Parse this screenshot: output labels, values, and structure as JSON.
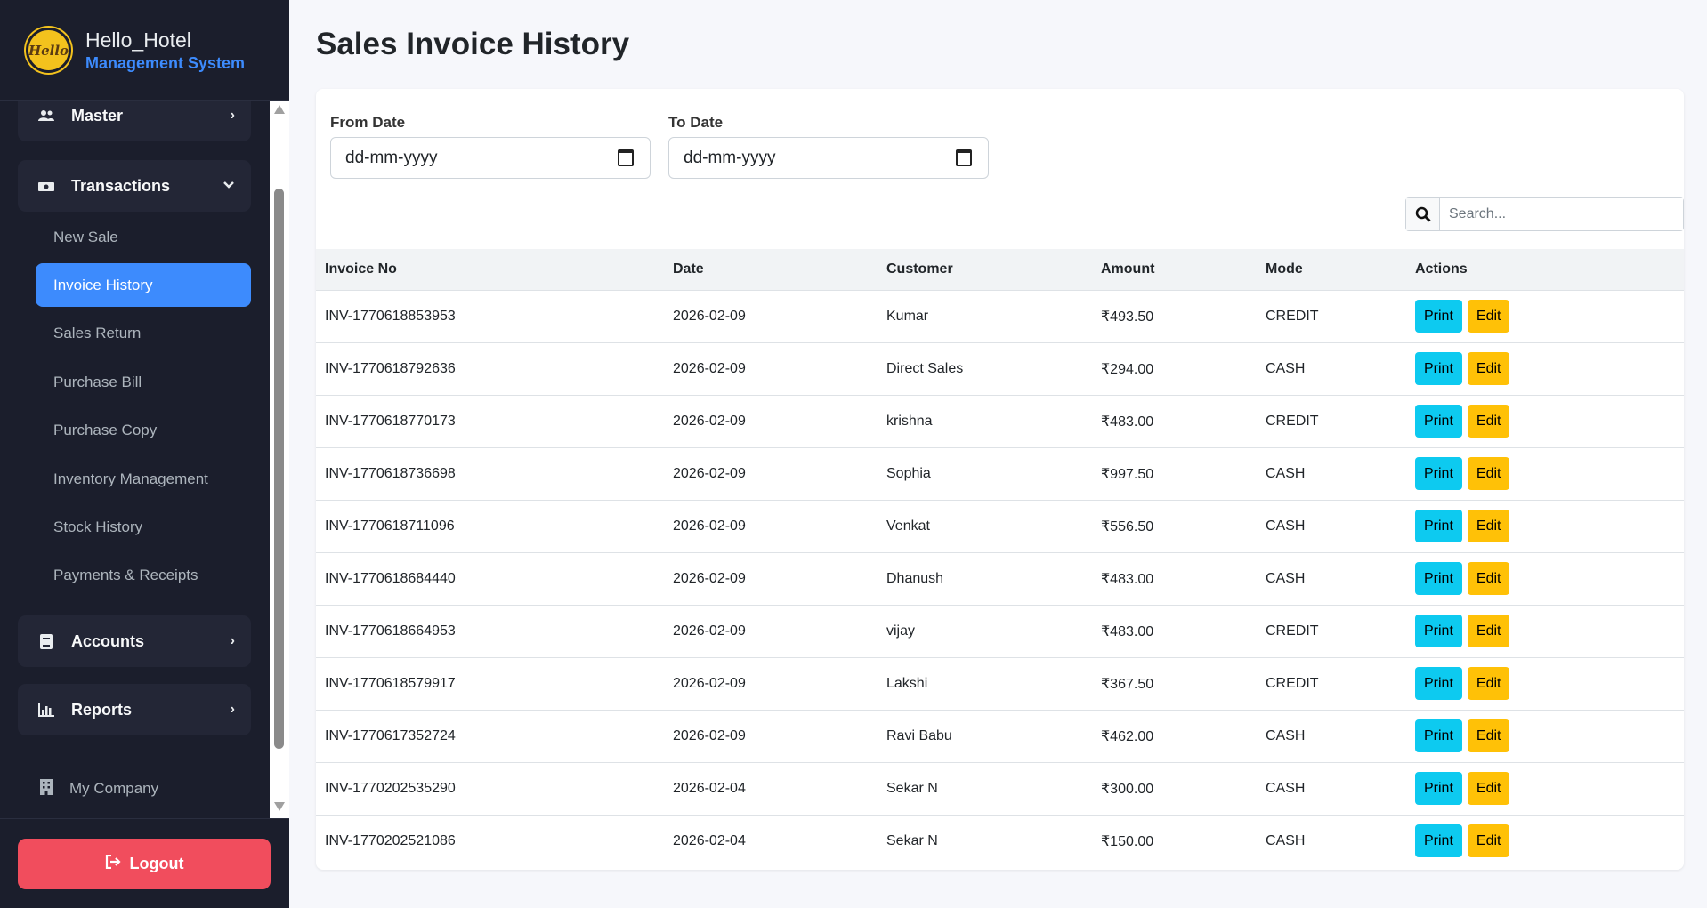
{
  "brand": {
    "title": "Hello_Hotel",
    "subtitle": "Management System",
    "logo_text": "Hello"
  },
  "sidebar": {
    "groups": [
      {
        "label": "Master",
        "icon": "users-icon"
      },
      {
        "label": "Transactions",
        "icon": "money-icon"
      },
      {
        "label": "Accounts",
        "icon": "book-icon"
      },
      {
        "label": "Reports",
        "icon": "chart-icon"
      }
    ],
    "sub_items": [
      "New Sale",
      "Invoice History",
      "Sales Return",
      "Purchase Bill",
      "Purchase Copy",
      "Inventory Management",
      "Stock History",
      "Payments & Receipts"
    ],
    "active_item": "Invoice History",
    "company": "My Company",
    "logout": "Logout"
  },
  "page": {
    "title": "Sales Invoice History"
  },
  "filters": {
    "from_label": "From Date",
    "to_label": "To Date",
    "from_value": "dd-mm-yyyy",
    "to_value": "dd-mm-yyyy",
    "search_placeholder": "Search..."
  },
  "table": {
    "headers": [
      "Invoice No",
      "Date",
      "Customer",
      "Amount",
      "Mode",
      "Actions"
    ],
    "print_label": "Print",
    "edit_label": "Edit",
    "rows": [
      {
        "invoice": "INV-1770618853953",
        "date": "2026-02-09",
        "customer": "Kumar",
        "amount": "₹493.50",
        "mode": "CREDIT"
      },
      {
        "invoice": "INV-1770618792636",
        "date": "2026-02-09",
        "customer": "Direct Sales",
        "amount": "₹294.00",
        "mode": "CASH"
      },
      {
        "invoice": "INV-1770618770173",
        "date": "2026-02-09",
        "customer": "krishna",
        "amount": "₹483.00",
        "mode": "CREDIT"
      },
      {
        "invoice": "INV-1770618736698",
        "date": "2026-02-09",
        "customer": "Sophia",
        "amount": "₹997.50",
        "mode": "CASH"
      },
      {
        "invoice": "INV-1770618711096",
        "date": "2026-02-09",
        "customer": "Venkat",
        "amount": "₹556.50",
        "mode": "CASH"
      },
      {
        "invoice": "INV-1770618684440",
        "date": "2026-02-09",
        "customer": "Dhanush",
        "amount": "₹483.00",
        "mode": "CASH"
      },
      {
        "invoice": "INV-1770618664953",
        "date": "2026-02-09",
        "customer": "vijay",
        "amount": "₹483.00",
        "mode": "CREDIT"
      },
      {
        "invoice": "INV-1770618579917",
        "date": "2026-02-09",
        "customer": "Lakshi",
        "amount": "₹367.50",
        "mode": "CREDIT"
      },
      {
        "invoice": "INV-1770617352724",
        "date": "2026-02-09",
        "customer": "Ravi Babu",
        "amount": "₹462.00",
        "mode": "CASH"
      },
      {
        "invoice": "INV-1770202535290",
        "date": "2026-02-04",
        "customer": "Sekar N",
        "amount": "₹300.00",
        "mode": "CASH"
      },
      {
        "invoice": "INV-1770202521086",
        "date": "2026-02-04",
        "customer": "Sekar N",
        "amount": "₹150.00",
        "mode": "CASH"
      }
    ]
  },
  "colors": {
    "sidebar_bg": "#1b1e2c",
    "active": "#3d8bfd",
    "print": "#0dcaf0",
    "edit": "#ffc107",
    "logout": "#f14d5d"
  }
}
